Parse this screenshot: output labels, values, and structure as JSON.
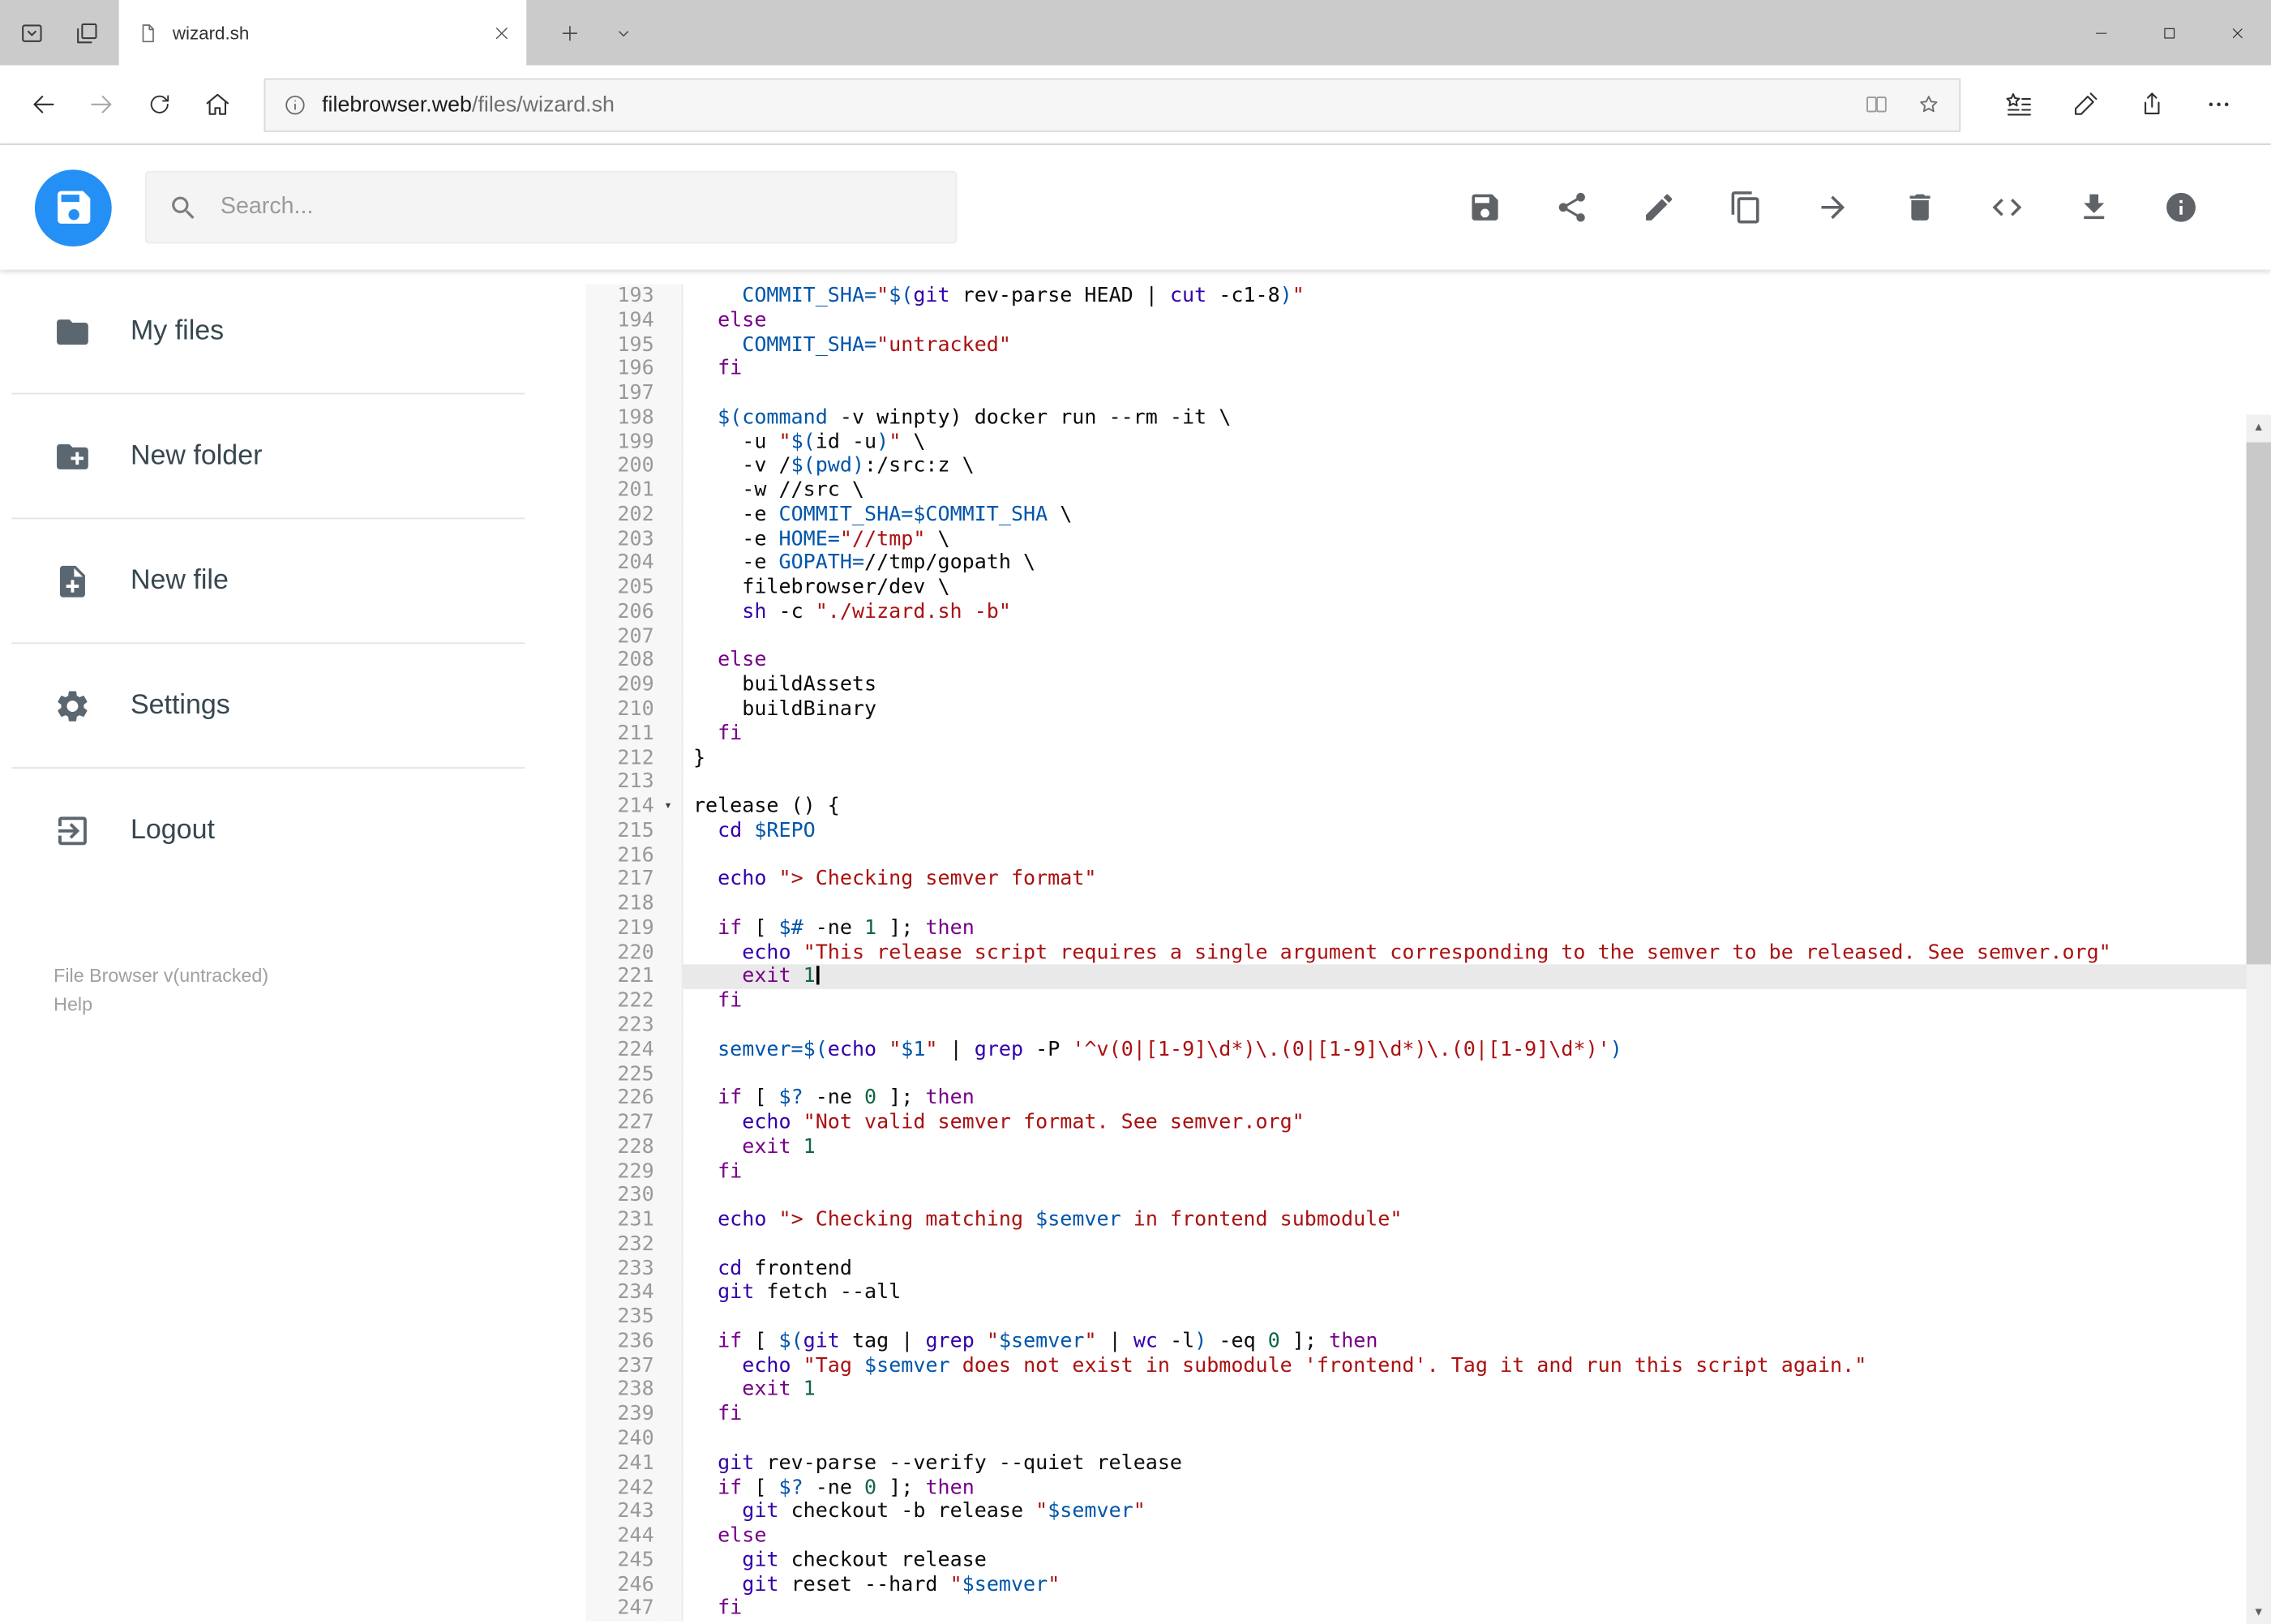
{
  "window": {
    "tab_title": "wizard.sh"
  },
  "browser": {
    "url_domain": "filebrowser.web",
    "url_path": "/files/wizard.sh"
  },
  "header": {
    "search_placeholder": "Search...",
    "actions": [
      {
        "name": "save"
      },
      {
        "name": "share"
      },
      {
        "name": "rename"
      },
      {
        "name": "copy"
      },
      {
        "name": "move"
      },
      {
        "name": "delete"
      },
      {
        "name": "code"
      },
      {
        "name": "download"
      },
      {
        "name": "info"
      }
    ]
  },
  "sidebar": {
    "items": [
      {
        "icon": "folder",
        "label": "My files"
      },
      {
        "icon": "folder-plus",
        "label": "New folder"
      },
      {
        "icon": "file-plus",
        "label": "New file"
      },
      {
        "icon": "settings",
        "label": "Settings"
      },
      {
        "icon": "logout",
        "label": "Logout"
      }
    ],
    "footer": {
      "version": "File Browser v(untracked)",
      "help": "Help"
    }
  },
  "colors": {
    "accent": "#2490f5",
    "tabbar_bg": "#cbcbcb",
    "active_line_bg": "#e9e9e9",
    "token_keyword": "#770088",
    "token_builtin": "#3300aa",
    "token_variable": "#0055aa",
    "token_string": "#aa1111",
    "token_number": "#116644"
  },
  "editor": {
    "active_line": 221,
    "cursor_line": 221,
    "fold_line": 214,
    "lines": [
      {
        "n": 193,
        "s": [
          [
            "t",
            "    "
          ],
          [
            "v",
            "COMMIT_SHA="
          ],
          [
            "s",
            "\""
          ],
          [
            "v",
            "$("
          ],
          [
            "b",
            "git"
          ],
          [
            "t",
            " rev-parse HEAD | "
          ],
          [
            "b",
            "cut"
          ],
          [
            "t",
            " -c1-8"
          ],
          [
            "v",
            ")"
          ],
          [
            "s",
            "\""
          ]
        ]
      },
      {
        "n": 194,
        "s": [
          [
            "t",
            "  "
          ],
          [
            "k",
            "else"
          ]
        ]
      },
      {
        "n": 195,
        "s": [
          [
            "t",
            "    "
          ],
          [
            "v",
            "COMMIT_SHA="
          ],
          [
            "s",
            "\"untracked\""
          ]
        ]
      },
      {
        "n": 196,
        "s": [
          [
            "t",
            "  "
          ],
          [
            "k",
            "fi"
          ]
        ]
      },
      {
        "n": 197,
        "s": []
      },
      {
        "n": 198,
        "s": [
          [
            "t",
            "  "
          ],
          [
            "v",
            "$(command"
          ],
          [
            "t",
            " -v winpty) docker run --rm -it \\"
          ]
        ]
      },
      {
        "n": 199,
        "s": [
          [
            "t",
            "    -u "
          ],
          [
            "s",
            "\""
          ],
          [
            "v",
            "$("
          ],
          [
            "t",
            "id -u"
          ],
          [
            "v",
            ")"
          ],
          [
            "s",
            "\""
          ],
          [
            "t",
            " \\"
          ]
        ]
      },
      {
        "n": 200,
        "s": [
          [
            "t",
            "    -v /"
          ],
          [
            "v",
            "$(pwd)"
          ],
          [
            "t",
            ":/src:z \\"
          ]
        ]
      },
      {
        "n": 201,
        "s": [
          [
            "t",
            "    -w //src \\"
          ]
        ]
      },
      {
        "n": 202,
        "s": [
          [
            "t",
            "    -e "
          ],
          [
            "v",
            "COMMIT_SHA=$COMMIT_SHA"
          ],
          [
            "t",
            " \\"
          ]
        ]
      },
      {
        "n": 203,
        "s": [
          [
            "t",
            "    -e "
          ],
          [
            "v",
            "HOME="
          ],
          [
            "s",
            "\"//tmp\""
          ],
          [
            "t",
            " \\"
          ]
        ]
      },
      {
        "n": 204,
        "s": [
          [
            "t",
            "    -e "
          ],
          [
            "v",
            "GOPATH="
          ],
          [
            "t",
            "//tmp/gopath \\"
          ]
        ]
      },
      {
        "n": 205,
        "s": [
          [
            "t",
            "    filebrowser/dev \\"
          ]
        ]
      },
      {
        "n": 206,
        "s": [
          [
            "t",
            "    "
          ],
          [
            "b",
            "sh"
          ],
          [
            "t",
            " -c "
          ],
          [
            "s",
            "\"./wizard.sh -b\""
          ]
        ]
      },
      {
        "n": 207,
        "s": []
      },
      {
        "n": 208,
        "s": [
          [
            "t",
            "  "
          ],
          [
            "k",
            "else"
          ]
        ]
      },
      {
        "n": 209,
        "s": [
          [
            "t",
            "    buildAssets"
          ]
        ]
      },
      {
        "n": 210,
        "s": [
          [
            "t",
            "    buildBinary"
          ]
        ]
      },
      {
        "n": 211,
        "s": [
          [
            "t",
            "  "
          ],
          [
            "k",
            "fi"
          ]
        ]
      },
      {
        "n": 212,
        "s": [
          [
            "t",
            "}"
          ]
        ]
      },
      {
        "n": 213,
        "s": []
      },
      {
        "n": 214,
        "s": [
          [
            "t",
            "release () {"
          ]
        ]
      },
      {
        "n": 215,
        "s": [
          [
            "t",
            "  "
          ],
          [
            "b",
            "cd"
          ],
          [
            "t",
            " "
          ],
          [
            "v",
            "$REPO"
          ]
        ]
      },
      {
        "n": 216,
        "s": []
      },
      {
        "n": 217,
        "s": [
          [
            "t",
            "  "
          ],
          [
            "b",
            "echo"
          ],
          [
            "t",
            " "
          ],
          [
            "s",
            "\"> Checking semver format\""
          ]
        ]
      },
      {
        "n": 218,
        "s": []
      },
      {
        "n": 219,
        "s": [
          [
            "t",
            "  "
          ],
          [
            "k",
            "if"
          ],
          [
            "t",
            " [ "
          ],
          [
            "v",
            "$#"
          ],
          [
            "t",
            " -ne "
          ],
          [
            "n",
            "1"
          ],
          [
            "t",
            " ]; "
          ],
          [
            "k",
            "then"
          ]
        ]
      },
      {
        "n": 220,
        "s": [
          [
            "t",
            "    "
          ],
          [
            "b",
            "echo"
          ],
          [
            "t",
            " "
          ],
          [
            "s",
            "\"This release script requires a single argument corresponding to the semver to be released. See semver.org\""
          ]
        ]
      },
      {
        "n": 221,
        "s": [
          [
            "t",
            "    "
          ],
          [
            "k",
            "exit"
          ],
          [
            "t",
            " "
          ],
          [
            "n",
            "1"
          ]
        ]
      },
      {
        "n": 222,
        "s": [
          [
            "t",
            "  "
          ],
          [
            "k",
            "fi"
          ]
        ]
      },
      {
        "n": 223,
        "s": []
      },
      {
        "n": 224,
        "s": [
          [
            "t",
            "  "
          ],
          [
            "v",
            "semver=$("
          ],
          [
            "b",
            "echo"
          ],
          [
            "t",
            " "
          ],
          [
            "s",
            "\""
          ],
          [
            "v",
            "$1"
          ],
          [
            "s",
            "\""
          ],
          [
            "t",
            " | "
          ],
          [
            "b",
            "grep"
          ],
          [
            "t",
            " -P "
          ],
          [
            "s",
            "'^v(0|[1-9]\\d*)\\.(0|[1-9]\\d*)\\.(0|[1-9]\\d*)'"
          ],
          [
            "v",
            ")"
          ]
        ]
      },
      {
        "n": 225,
        "s": []
      },
      {
        "n": 226,
        "s": [
          [
            "t",
            "  "
          ],
          [
            "k",
            "if"
          ],
          [
            "t",
            " [ "
          ],
          [
            "v",
            "$?"
          ],
          [
            "t",
            " -ne "
          ],
          [
            "n",
            "0"
          ],
          [
            "t",
            " ]; "
          ],
          [
            "k",
            "then"
          ]
        ]
      },
      {
        "n": 227,
        "s": [
          [
            "t",
            "    "
          ],
          [
            "b",
            "echo"
          ],
          [
            "t",
            " "
          ],
          [
            "s",
            "\"Not valid semver format. See semver.org\""
          ]
        ]
      },
      {
        "n": 228,
        "s": [
          [
            "t",
            "    "
          ],
          [
            "k",
            "exit"
          ],
          [
            "t",
            " "
          ],
          [
            "n",
            "1"
          ]
        ]
      },
      {
        "n": 229,
        "s": [
          [
            "t",
            "  "
          ],
          [
            "k",
            "fi"
          ]
        ]
      },
      {
        "n": 230,
        "s": []
      },
      {
        "n": 231,
        "s": [
          [
            "t",
            "  "
          ],
          [
            "b",
            "echo"
          ],
          [
            "t",
            " "
          ],
          [
            "s",
            "\"> Checking matching "
          ],
          [
            "v",
            "$semver"
          ],
          [
            "s",
            " in frontend submodule\""
          ]
        ]
      },
      {
        "n": 232,
        "s": []
      },
      {
        "n": 233,
        "s": [
          [
            "t",
            "  "
          ],
          [
            "b",
            "cd"
          ],
          [
            "t",
            " frontend"
          ]
        ]
      },
      {
        "n": 234,
        "s": [
          [
            "t",
            "  "
          ],
          [
            "b",
            "git"
          ],
          [
            "t",
            " fetch --all"
          ]
        ]
      },
      {
        "n": 235,
        "s": []
      },
      {
        "n": 236,
        "s": [
          [
            "t",
            "  "
          ],
          [
            "k",
            "if"
          ],
          [
            "t",
            " [ "
          ],
          [
            "v",
            "$("
          ],
          [
            "b",
            "git"
          ],
          [
            "t",
            " tag | "
          ],
          [
            "b",
            "grep"
          ],
          [
            "t",
            " "
          ],
          [
            "s",
            "\""
          ],
          [
            "v",
            "$semver"
          ],
          [
            "s",
            "\""
          ],
          [
            "t",
            " | "
          ],
          [
            "b",
            "wc"
          ],
          [
            "t",
            " -l"
          ],
          [
            "v",
            ")"
          ],
          [
            "t",
            " -eq "
          ],
          [
            "n",
            "0"
          ],
          [
            "t",
            " ]; "
          ],
          [
            "k",
            "then"
          ]
        ]
      },
      {
        "n": 237,
        "s": [
          [
            "t",
            "    "
          ],
          [
            "b",
            "echo"
          ],
          [
            "t",
            " "
          ],
          [
            "s",
            "\"Tag "
          ],
          [
            "v",
            "$semver"
          ],
          [
            "s",
            " does not exist in submodule 'frontend'. Tag it and run this script again.\""
          ]
        ]
      },
      {
        "n": 238,
        "s": [
          [
            "t",
            "    "
          ],
          [
            "k",
            "exit"
          ],
          [
            "t",
            " "
          ],
          [
            "n",
            "1"
          ]
        ]
      },
      {
        "n": 239,
        "s": [
          [
            "t",
            "  "
          ],
          [
            "k",
            "fi"
          ]
        ]
      },
      {
        "n": 240,
        "s": []
      },
      {
        "n": 241,
        "s": [
          [
            "t",
            "  "
          ],
          [
            "b",
            "git"
          ],
          [
            "t",
            " rev-parse --verify --quiet release"
          ]
        ]
      },
      {
        "n": 242,
        "s": [
          [
            "t",
            "  "
          ],
          [
            "k",
            "if"
          ],
          [
            "t",
            " [ "
          ],
          [
            "v",
            "$?"
          ],
          [
            "t",
            " -ne "
          ],
          [
            "n",
            "0"
          ],
          [
            "t",
            " ]; "
          ],
          [
            "k",
            "then"
          ]
        ]
      },
      {
        "n": 243,
        "s": [
          [
            "t",
            "    "
          ],
          [
            "b",
            "git"
          ],
          [
            "t",
            " checkout -b release "
          ],
          [
            "s",
            "\""
          ],
          [
            "v",
            "$semver"
          ],
          [
            "s",
            "\""
          ]
        ]
      },
      {
        "n": 244,
        "s": [
          [
            "t",
            "  "
          ],
          [
            "k",
            "else"
          ]
        ]
      },
      {
        "n": 245,
        "s": [
          [
            "t",
            "    "
          ],
          [
            "b",
            "git"
          ],
          [
            "t",
            " checkout release"
          ]
        ]
      },
      {
        "n": 246,
        "s": [
          [
            "t",
            "    "
          ],
          [
            "b",
            "git"
          ],
          [
            "t",
            " reset --hard "
          ],
          [
            "s",
            "\""
          ],
          [
            "v",
            "$semver"
          ],
          [
            "s",
            "\""
          ]
        ]
      },
      {
        "n": 247,
        "s": [
          [
            "t",
            "  "
          ],
          [
            "k",
            "fi"
          ]
        ]
      }
    ]
  }
}
